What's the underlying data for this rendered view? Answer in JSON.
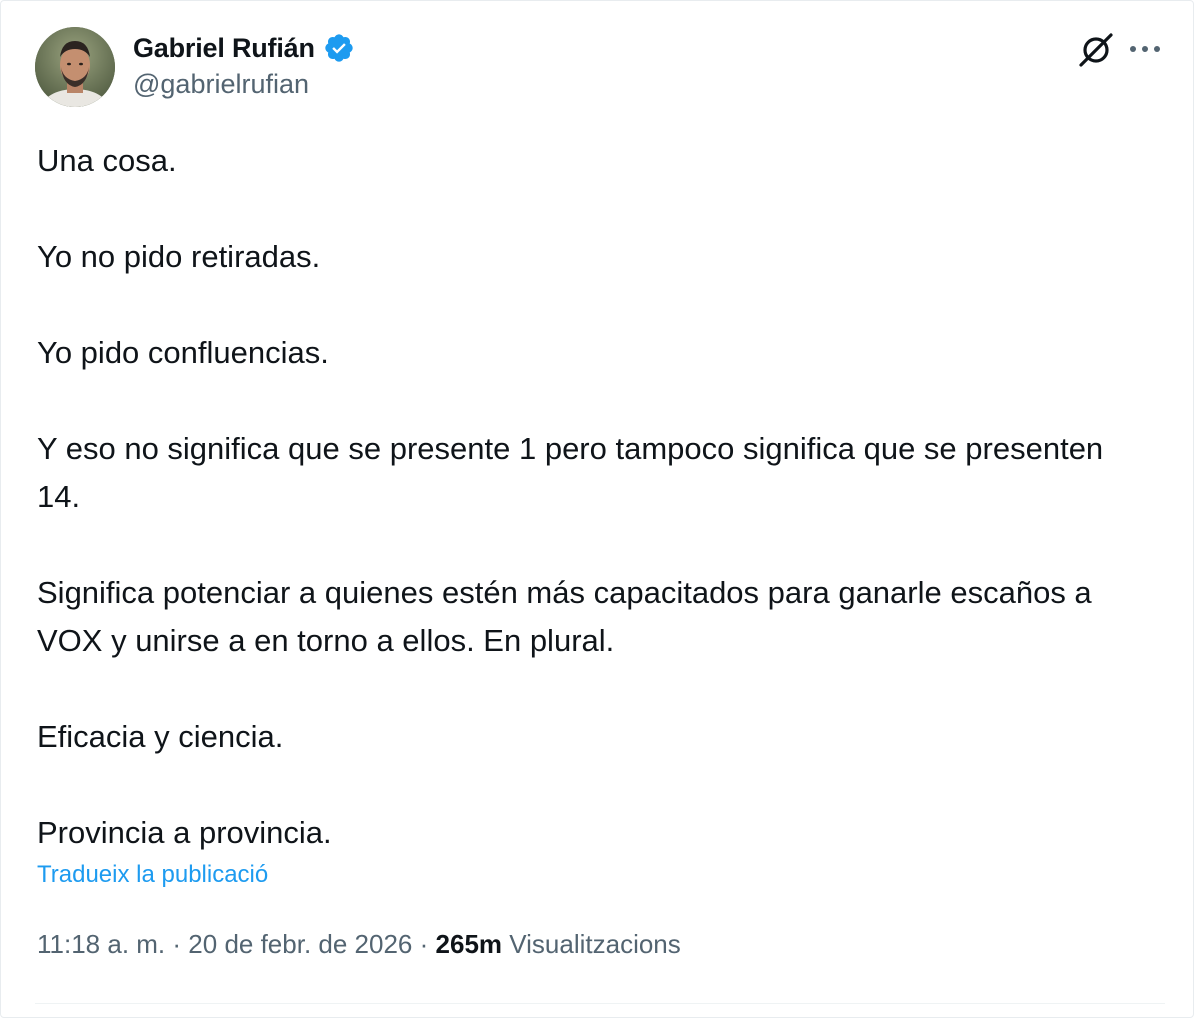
{
  "user": {
    "display_name": "Gabriel Rufián",
    "handle": "@gabrielrufian",
    "verified": true,
    "verified_color": "#1d9bf0"
  },
  "icons": {
    "grok": "grok-icon",
    "more": "more-horizontal-icon",
    "verified": "verified-badge-icon"
  },
  "tweet": {
    "paragraphs": [
      "Una cosa.",
      "Yo no pido retiradas.",
      "Yo pido confluencias.",
      "Y eso no significa que se presente 1 pero tampoco significa que se presenten 14.",
      "Significa potenciar a quienes estén más capacitados para ganarle escaños a VOX y unirse a en torno a ellos. En plural.",
      "Eficacia y ciencia.",
      "Provincia a provincia."
    ],
    "translate_label": "Tradueix la publicació"
  },
  "meta": {
    "time": "11:18 a. m.",
    "separator": "·",
    "date": "20 de febr. de 2026",
    "views_count": "265m",
    "views_label": "Visualitzacions"
  },
  "colors": {
    "text": "#0f1419",
    "secondary": "#536471",
    "accent": "#1d9bf0"
  }
}
